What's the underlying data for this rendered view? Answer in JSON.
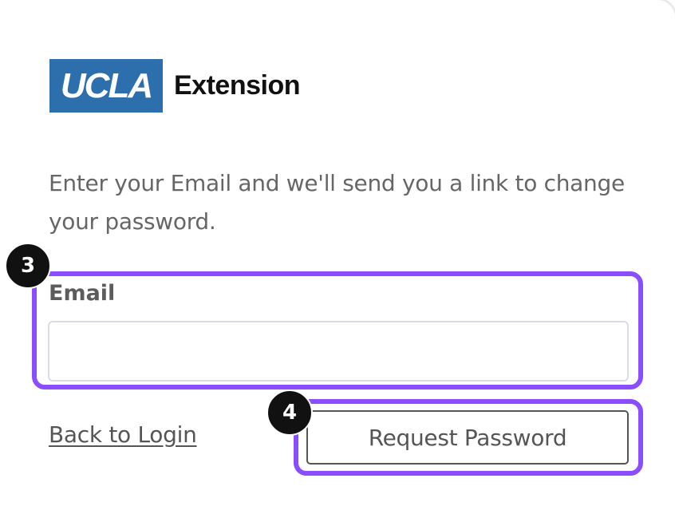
{
  "logo": {
    "mark": "UCLA",
    "word": "Extension"
  },
  "form": {
    "instructions": "Enter your Email and we'll send you a link to change your password.",
    "email_label": "Email",
    "email_value": "",
    "back_link": "Back to Login",
    "submit_label": "Request Password"
  },
  "annotations": {
    "step_email": "3",
    "step_button": "4",
    "highlight_color": "#8a4dff"
  },
  "colors": {
    "brand_blue": "#2d6fad",
    "text_gray": "#666666"
  }
}
